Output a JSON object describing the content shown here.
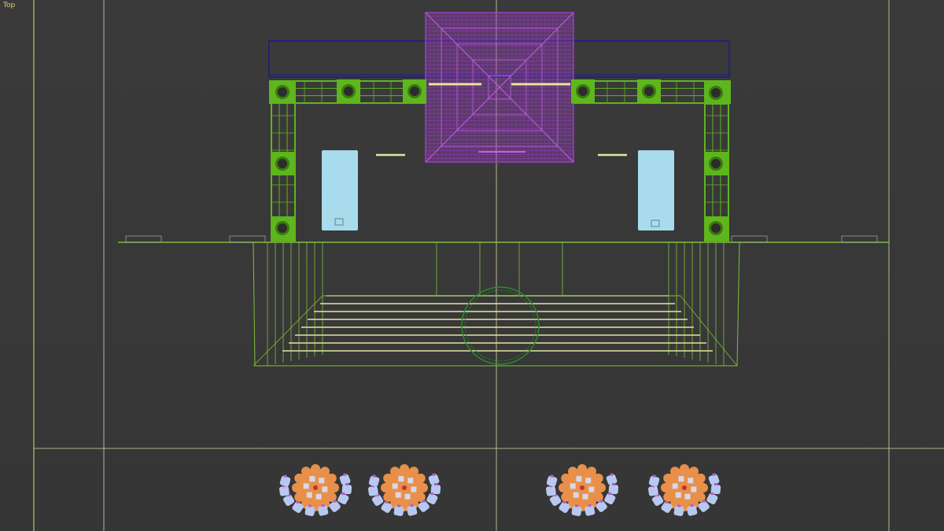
{
  "viewport": {
    "label": "Top",
    "view_name": "front-orthographic-viewport"
  },
  "scene": {
    "truss_color": "#5fb51d",
    "truss_dark": "#3a7a10",
    "pyramid_color": "#9b3dc4",
    "header_outline_color": "#1a1a8c",
    "screen_color": "#a8dcec",
    "grid_line_color": "#d8d8a0",
    "stair_color": "#7fbf3a",
    "circle_color": "#2a8a2a",
    "table_color": "#e8904a",
    "chair_color": "#b8c8f0",
    "chair_accent": "#b060c0"
  },
  "table_groups_count": 4
}
